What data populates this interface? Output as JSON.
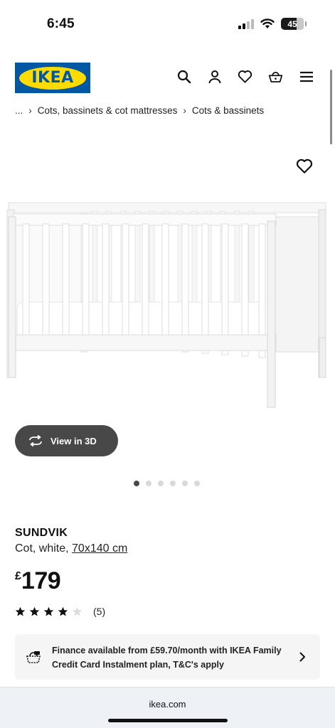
{
  "status_bar": {
    "time": "6:45",
    "battery": "45"
  },
  "header": {
    "logo_text": "IKEA",
    "icons": [
      "search-icon",
      "account-icon",
      "wishlist-icon",
      "basket-icon",
      "menu-icon"
    ]
  },
  "breadcrumb": {
    "ellipsis": "...",
    "items": [
      "Cots, bassinets & cot mattresses",
      "Cots & bassinets"
    ]
  },
  "gallery": {
    "view3d_label": "View in 3D",
    "image_count": 6,
    "active_index": 0
  },
  "product": {
    "name": "SUNDVIK",
    "description": "Cot, white, ",
    "size": "70x140 cm",
    "currency": "£",
    "price": "179",
    "rating": 4,
    "rating_max": 5,
    "review_count": "(5)"
  },
  "finance": {
    "text": "Finance available from £59.70/month with IKEA Family Credit Card Instalment plan, T&C's apply"
  },
  "browser": {
    "url": "ikea.com"
  },
  "colors": {
    "brand_blue": "#0058a3",
    "brand_yellow": "#ffdb00",
    "dark_gray": "#484848"
  }
}
